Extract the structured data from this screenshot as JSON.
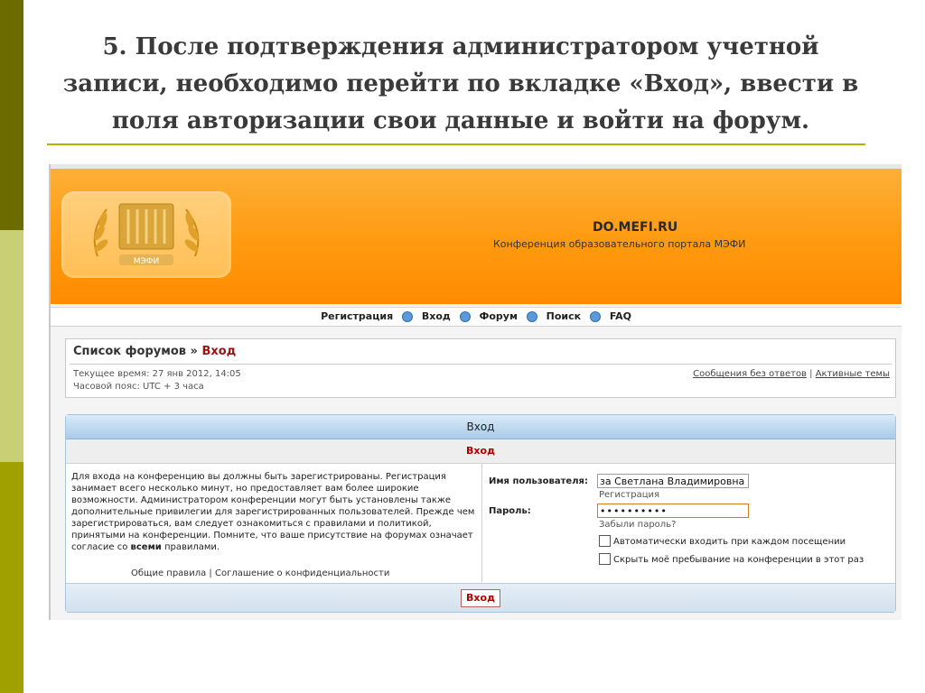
{
  "slide": {
    "title": "5. После подтверждения администратором учетной записи, необходимо перейти по вкладке «Вход», ввести в поля авторизации свои данные и войти на форум."
  },
  "site": {
    "name": "DO.MEFI.RU",
    "description": "Конференция образовательного портала МЭФИ",
    "logo_text": "МЭФИ"
  },
  "nav": {
    "items": [
      {
        "label": "Регистрация"
      },
      {
        "label": "Вход"
      },
      {
        "label": "Форум"
      },
      {
        "label": "Поиск"
      },
      {
        "label": "FAQ"
      }
    ]
  },
  "breadcrumb": {
    "root": "Список форумов",
    "separator": "»",
    "current": "Вход"
  },
  "info": {
    "current_time": "Текущее время: 27 янв 2012, 14:05",
    "timezone": "Часовой пояс: UTC + 3 часа",
    "unanswered": "Сообщения без ответов",
    "divider": "|",
    "active": "Активные темы"
  },
  "login": {
    "header": "Вход",
    "subheader": "Вход",
    "intro_text": "Для входа на конференцию вы должны быть зарегистрированы. Регистрация занимает всего несколько минут, но предоставляет вам более широкие возможности. Администратором конференции могут быть установлены также дополнительные привилегии для зарегистрированных пользователей. Прежде чем зарегистрироваться, вам следует ознакомиться с правилами и политикой, принятыми на конференции. Помните, что ваше присутствие на форумах означает согласие со",
    "intro_bold": "всеми",
    "intro_tail": "правилами.",
    "rules_link": "Общие правила",
    "links_divider": "|",
    "privacy_link": "Соглашение о конфиденциальности",
    "username_label": "Имя пользователя:",
    "username_value": "за Светлана Владимировна",
    "register_link": "Регистрация",
    "password_label": "Пароль:",
    "password_value": "••••••••••",
    "forgot_link": "Забыли пароль?",
    "autologin_label": "Автоматически входить при каждом посещении",
    "hide_label": "Скрыть моё пребывание на конференции в этот раз",
    "submit_label": "Вход"
  },
  "colors": {
    "banner": "#ff9a10",
    "accent_red": "#b00000",
    "strip_dark": "#6b6b00",
    "strip_light": "#c9cf74",
    "strip_mid": "#a0a000"
  }
}
